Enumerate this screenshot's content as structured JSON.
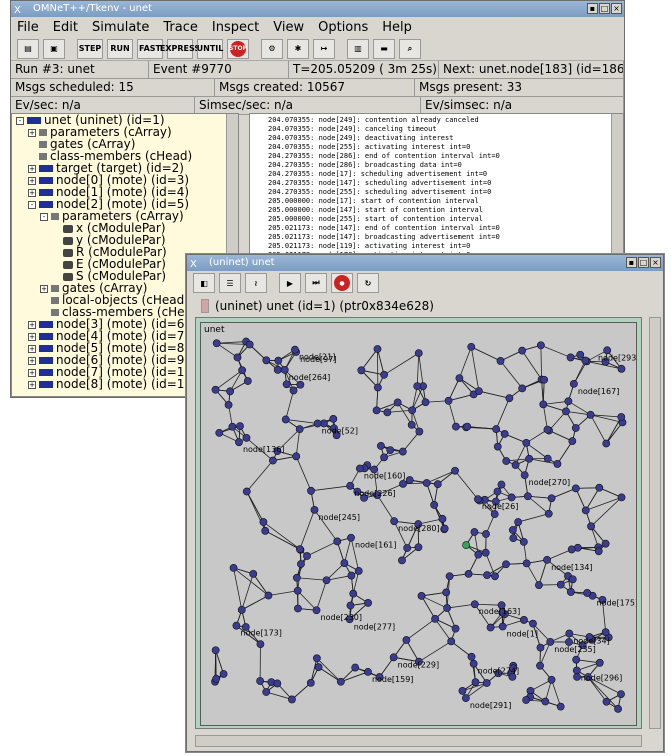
{
  "main_window": {
    "title": "OMNeT++/Tkenv - unet",
    "menu": [
      "File",
      "Edit",
      "Simulate",
      "Trace",
      "Inspect",
      "View",
      "Options",
      "Help"
    ],
    "toolbar": [
      "open-icon",
      "save-icon",
      "STEP",
      "RUN",
      "FAST",
      "EXPRESS",
      "UNTIL",
      "STOP",
      "find-icon",
      "network-icon",
      "timeline-icon",
      "stats-icon",
      "msg-icon",
      "search-icon"
    ],
    "status1": {
      "run": "Run #3: unet",
      "event": "Event #9770",
      "time": "T=205.05209 ( 3m 25s)",
      "next": "Next: unet.node[183] (id=186)"
    },
    "status2": {
      "scheduled": "Msgs scheduled: 15",
      "created": "Msgs created: 10567",
      "present": "Msgs present: 33"
    },
    "status3": {
      "evsec": "Ev/sec: n/a",
      "simsec": "Simsec/sec: n/a",
      "evsimsec": "Ev/simsec: n/a"
    },
    "tree": [
      {
        "depth": 0,
        "tog": "-",
        "icon": "net",
        "label": "unet (uninet) (id=1)"
      },
      {
        "depth": 1,
        "tog": "+",
        "icon": "gray",
        "label": "parameters (cArray)"
      },
      {
        "depth": 1,
        "tog": "",
        "icon": "gray",
        "label": "gates (cArray)"
      },
      {
        "depth": 1,
        "tog": "",
        "icon": "gray",
        "label": "class-members (cHead)"
      },
      {
        "depth": 1,
        "tog": "+",
        "icon": "mod",
        "label": "target (target) (id=2)"
      },
      {
        "depth": 1,
        "tog": "+",
        "icon": "mod",
        "label": "node[0] (mote) (id=3)"
      },
      {
        "depth": 1,
        "tog": "+",
        "icon": "mod",
        "label": "node[1] (mote) (id=4)"
      },
      {
        "depth": 1,
        "tog": "-",
        "icon": "mod",
        "label": "node[2] (mote) (id=5)"
      },
      {
        "depth": 2,
        "tog": "-",
        "icon": "gray",
        "label": "parameters (cArray)"
      },
      {
        "depth": 3,
        "tog": "",
        "icon": "par",
        "label": "x (cModulePar)"
      },
      {
        "depth": 3,
        "tog": "",
        "icon": "par",
        "label": "y (cModulePar)"
      },
      {
        "depth": 3,
        "tog": "",
        "icon": "par",
        "label": "R (cModulePar)"
      },
      {
        "depth": 3,
        "tog": "",
        "icon": "par",
        "label": "E (cModulePar)"
      },
      {
        "depth": 3,
        "tog": "",
        "icon": "par",
        "label": "S (cModulePar)"
      },
      {
        "depth": 2,
        "tog": "+",
        "icon": "gray",
        "label": "gates (cArray)"
      },
      {
        "depth": 2,
        "tog": "",
        "icon": "gray",
        "label": "local-objects (cHead)"
      },
      {
        "depth": 2,
        "tog": "",
        "icon": "gray",
        "label": "class-members (cHea"
      },
      {
        "depth": 1,
        "tog": "+",
        "icon": "mod",
        "label": "node[3] (mote) (id=6)"
      },
      {
        "depth": 1,
        "tog": "+",
        "icon": "mod",
        "label": "node[4] (mote) (id=7)"
      },
      {
        "depth": 1,
        "tog": "+",
        "icon": "mod",
        "label": "node[5] (mote) (id=8)"
      },
      {
        "depth": 1,
        "tog": "+",
        "icon": "mod",
        "label": "node[6] (mote) (id=9)"
      },
      {
        "depth": 1,
        "tog": "+",
        "icon": "mod",
        "label": "node[7] (mote) (id=10)"
      },
      {
        "depth": 1,
        "tog": "+",
        "icon": "mod",
        "label": "node[8] (mote) (id=11)"
      }
    ],
    "log": [
      "204.070355: node[249]: contention already canceled",
      "204.070355: node[249]: canceling timeout",
      "204.070355: node[249]: deactivating interest",
      "204.070355: node[255]: activating interest int=0",
      "204.270355: node[286]: end of contention interval int=0",
      "204.270355: node[286]: broadcasting data int=0",
      "204.270355: node[17]: scheduling advertisement int=0",
      "204.270355: node[147]: scheduling advertisement int=0",
      "204.270355: node[255]: scheduling advertisement int=0",
      "205.000000: node[17]: start of contention interval",
      "205.000000: node[147]: start of contention interval",
      "205.000000: node[255]: start of contention interval",
      "205.021173: node[147]: end of contention interval int=0",
      "205.021173: node[147]: broadcasting advertisement int=0",
      "205.021173: node[119]: activating interest int=0",
      "205.021173: node[178]: activating interest int=0"
    ]
  },
  "net_window": {
    "title": "(uninet) unet",
    "toolbar": [
      "parent-icon",
      "layout-icon",
      "step-icon",
      "run-icon",
      "fast-icon",
      "stop-icon",
      "relayout-icon"
    ],
    "info": "(uninet) unet  (id=1)  (ptr0x834e628)",
    "canvas_label": "unet",
    "node_labels": [
      "node[277]",
      "node[175]",
      "node[136]",
      "node[161]",
      "node[226]",
      "node[296]",
      "node[159]",
      "node[173]",
      "node[230]",
      "node[274]",
      "node[270]",
      "node[293]",
      "node[245]",
      "node[264]",
      "node[229]",
      "node[280]",
      "node[163]",
      "node[167]",
      "node[134]",
      "node[52]",
      "node[34]",
      "node[97]",
      "node[291]",
      "node[160]",
      "node[26]",
      "node[235]",
      "node[21]",
      "node[1]"
    ]
  }
}
